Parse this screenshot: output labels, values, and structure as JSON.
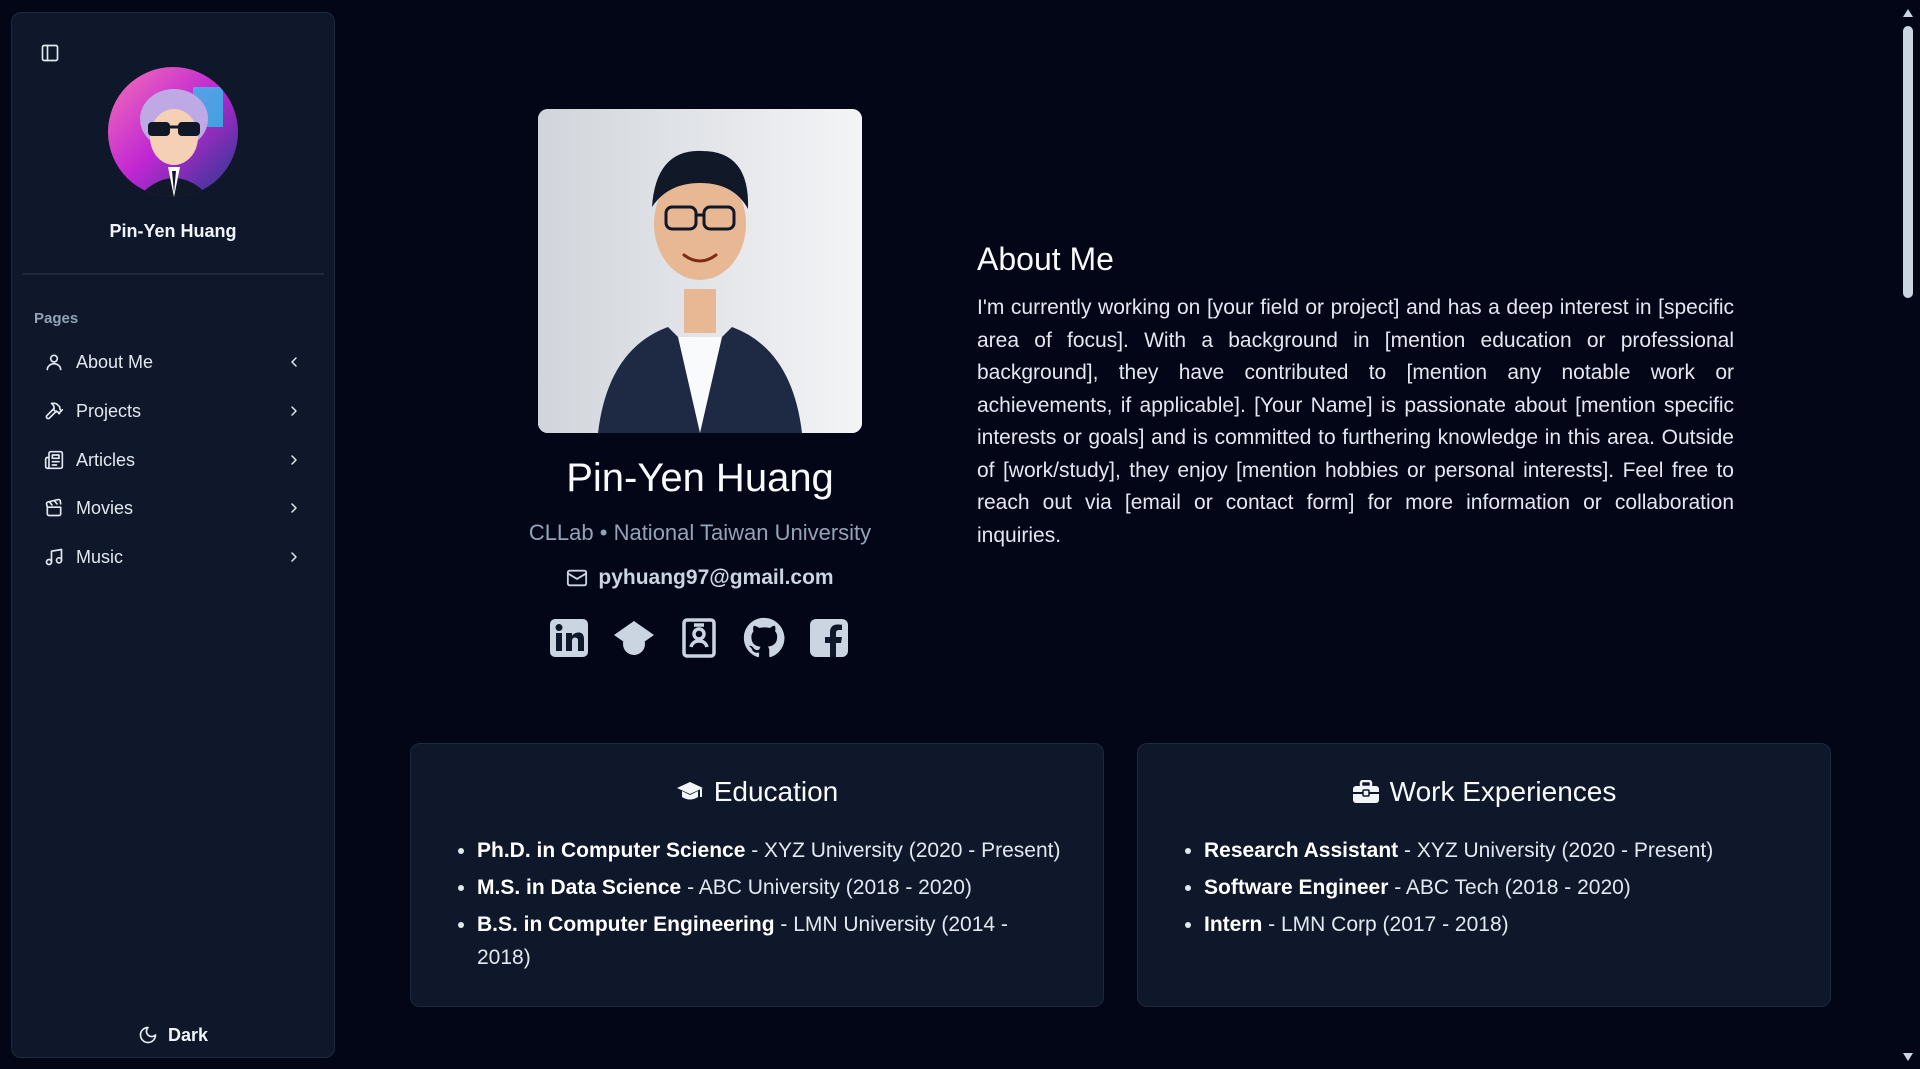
{
  "sidebar": {
    "toggle_icon": "sidebar-toggle-icon",
    "user_name": "Pin-Yen Huang",
    "section_label": "Pages",
    "items": [
      {
        "label": "About Me",
        "icon": "user-icon",
        "chevron": "chevron-left-icon"
      },
      {
        "label": "Projects",
        "icon": "hammer-icon",
        "chevron": "chevron-right-icon"
      },
      {
        "label": "Articles",
        "icon": "newspaper-icon",
        "chevron": "chevron-right-icon"
      },
      {
        "label": "Movies",
        "icon": "clapperboard-icon",
        "chevron": "chevron-right-icon"
      },
      {
        "label": "Music",
        "icon": "music-icon",
        "chevron": "chevron-right-icon"
      }
    ],
    "theme_label": "Dark",
    "theme_icon": "moon-icon"
  },
  "profile": {
    "name": "Pin-Yen Huang",
    "affiliation": "CLLab • National Taiwan University",
    "email": "pyhuang97@gmail.com",
    "socials": [
      "linkedin-icon",
      "google-scholar-icon",
      "contact-card-icon",
      "github-icon",
      "facebook-icon"
    ]
  },
  "about": {
    "title": "About Me",
    "text": "I'm currently working on [your field or project] and has a deep interest in [specific area of focus]. With a background in [mention education or professional background], they have contributed to [mention any notable work or achievements, if applicable]. [Your Name] is passionate about [mention specific interests or goals] and is committed to furthering knowledge in this area. Outside of [work/study], they enjoy [mention hobbies or personal interests]. Feel free to reach out via [email or contact form] for more information or collaboration inquiries."
  },
  "education": {
    "title": "Education",
    "items": [
      {
        "degree": "Ph.D. in Computer Science",
        "detail": " - XYZ University (2020 - Present)"
      },
      {
        "degree": "M.S. in Data Science",
        "detail": " - ABC University (2018 - 2020)"
      },
      {
        "degree": "B.S. in Computer Engineering",
        "detail": " - LMN University (2014 - 2018)"
      }
    ]
  },
  "work": {
    "title": "Work Experiences",
    "items": [
      {
        "role": "Research Assistant",
        "detail": " - XYZ University (2020 - Present)"
      },
      {
        "role": "Software Engineer",
        "detail": " - ABC Tech (2018 - 2020)"
      },
      {
        "role": "Intern",
        "detail": " - LMN Corp (2017 - 2018)"
      }
    ]
  },
  "colors": {
    "background": "#020617",
    "panel": "#0f172a",
    "border": "#1e293b",
    "muted": "#94a3b8"
  }
}
